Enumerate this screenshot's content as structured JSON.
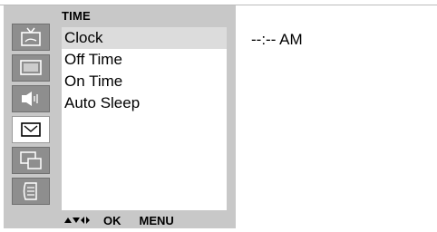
{
  "osd": {
    "title": "TIME",
    "icons": [
      {
        "name": "tv-picture-icon",
        "active": false
      },
      {
        "name": "screen-icon",
        "active": false
      },
      {
        "name": "speaker-sound-icon",
        "active": false
      },
      {
        "name": "clock-time-icon",
        "active": true
      },
      {
        "name": "pip-screens-icon",
        "active": false
      },
      {
        "name": "setup-book-icon",
        "active": false
      }
    ],
    "menu_items": [
      {
        "label": "Clock",
        "selected": true
      },
      {
        "label": "Off Time",
        "selected": false
      },
      {
        "label": "On Time",
        "selected": false
      },
      {
        "label": "Auto Sleep",
        "selected": false
      }
    ],
    "nav": {
      "ok_label": "OK",
      "menu_label": "MENU"
    }
  },
  "time_readout": "--:--  AM",
  "colors": {
    "osd_background": "#c8c8c8",
    "menu_background": "#ffffff",
    "selected_row": "#dcdcdc",
    "icon_inactive": "#8e8e8e",
    "icon_active": "#ffffff"
  }
}
